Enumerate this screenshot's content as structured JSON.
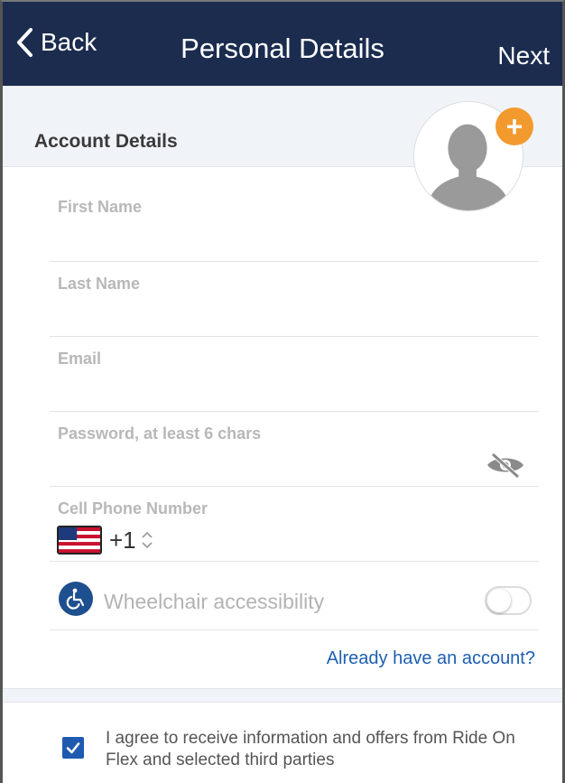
{
  "navbar": {
    "back_label": "Back",
    "title": "Personal Details",
    "next_label": "Next",
    "background_color": "#1b2c4f"
  },
  "section": {
    "title": "Account Details"
  },
  "avatar": {
    "icon": "person-silhouette-icon",
    "add_icon": "plus-icon",
    "add_color": "#f39a2e"
  },
  "fields": {
    "first_name": {
      "label": "First Name",
      "value": ""
    },
    "last_name": {
      "label": "Last Name",
      "value": ""
    },
    "email": {
      "label": "Email",
      "value": ""
    },
    "password": {
      "label": "Password, at least 6 chars",
      "value": "",
      "toggle_icon": "eye-slash-icon"
    },
    "phone": {
      "label": "Cell Phone Number",
      "country_flag": "us-flag-icon",
      "dial_code": "+1",
      "value": ""
    }
  },
  "wheelchair": {
    "icon": "wheelchair-icon",
    "label": "Wheelchair accessibility",
    "enabled": false
  },
  "login_link": "Already have an account?",
  "consent": {
    "checked": true,
    "text": "I agree to receive information and offers from Ride On Flex and selected third parties",
    "accent_color": "#1e5bb0"
  }
}
